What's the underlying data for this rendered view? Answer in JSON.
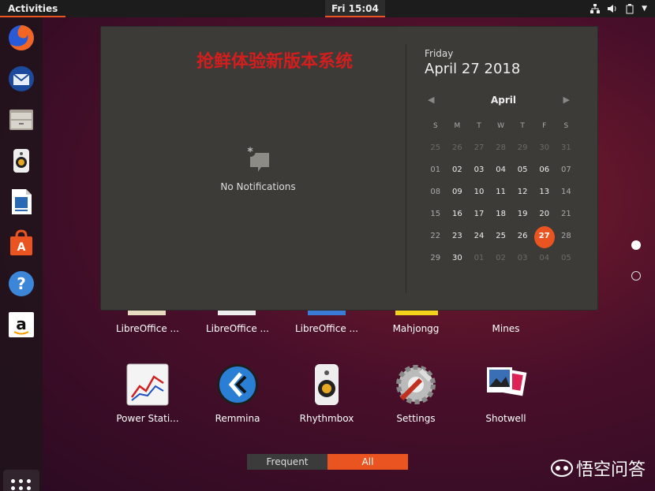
{
  "topbar": {
    "activities": "Activities",
    "clock": "Fri 15:04"
  },
  "dock": {
    "items": [
      "firefox-icon",
      "thunderbird-icon",
      "files-icon",
      "rhythmbox-icon",
      "libreoffice-writer-icon",
      "software-icon",
      "help-icon",
      "amazon-icon"
    ]
  },
  "overlay_text": "抢鲜体验新版本系统",
  "notifications": {
    "label": "No Notifications"
  },
  "calendar": {
    "day_of_week": "Friday",
    "full_date": "April 27 2018",
    "month": "April",
    "weekdays": [
      "S",
      "M",
      "T",
      "W",
      "T",
      "F",
      "S"
    ],
    "weeks": [
      [
        "25",
        "26",
        "27",
        "28",
        "29",
        "30",
        "31"
      ],
      [
        "01",
        "02",
        "03",
        "04",
        "05",
        "06",
        "07"
      ],
      [
        "08",
        "09",
        "10",
        "11",
        "12",
        "13",
        "14"
      ],
      [
        "15",
        "16",
        "17",
        "18",
        "19",
        "20",
        "21"
      ],
      [
        "22",
        "23",
        "24",
        "25",
        "26",
        "27",
        "28"
      ],
      [
        "29",
        "30",
        "01",
        "02",
        "03",
        "04",
        "05"
      ]
    ],
    "today": "27"
  },
  "apps_row1": [
    "LibreOffice ...",
    "LibreOffice ...",
    "LibreOffice ...",
    "Mahjongg",
    "Mines"
  ],
  "apps_row2": [
    "Power Stati...",
    "Remmina",
    "Rhythmbox",
    "Settings",
    "Shotwell"
  ],
  "tabs": {
    "frequent": "Frequent",
    "all": "All"
  },
  "watermark": "悟空问答",
  "colors": {
    "accent": "#e95420",
    "panel": "#3c3b37"
  }
}
